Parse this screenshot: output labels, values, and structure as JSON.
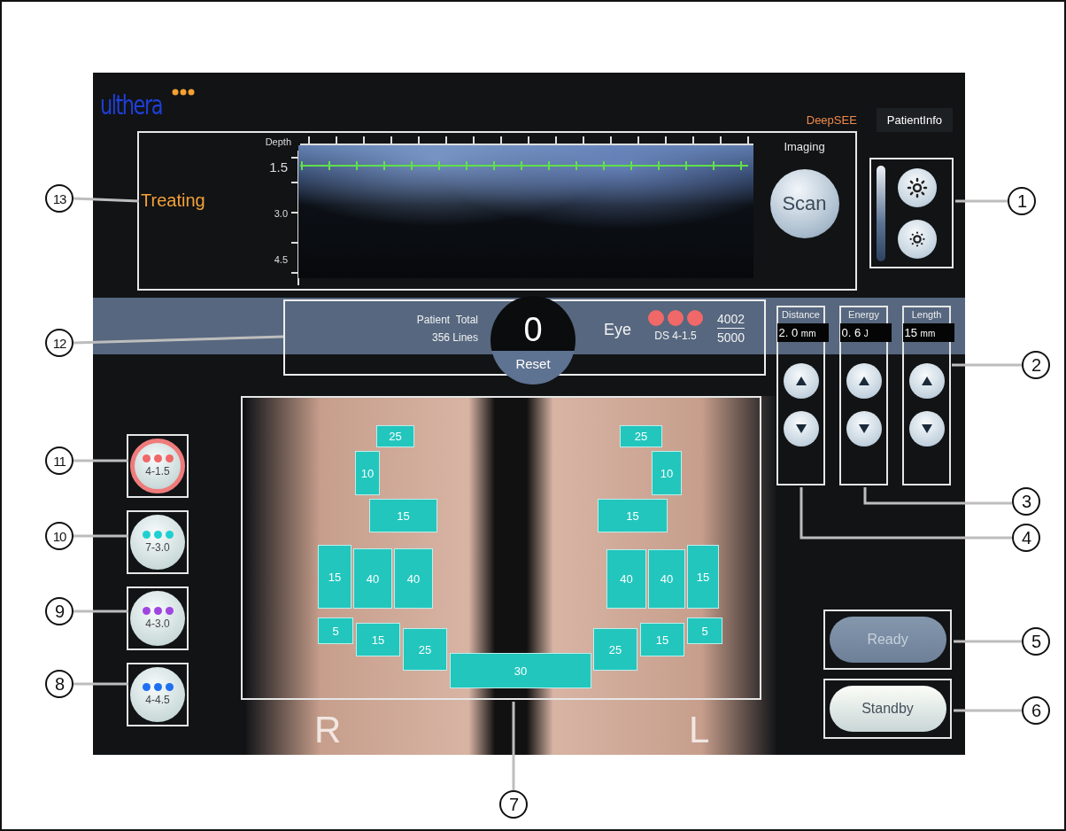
{
  "logo": {
    "text": "ulthera"
  },
  "tabs": [
    {
      "label": "DeepSEE",
      "selected": true
    },
    {
      "label": "PatientInfo",
      "selected": false
    }
  ],
  "imaging": {
    "status": "Treating",
    "depth_title": "Depth",
    "depth_labels": [
      "1.5",
      "3.0",
      "4.5"
    ],
    "title": "Imaging",
    "scan_button": "Scan"
  },
  "treatment_status": {
    "title": "Patient  Total",
    "lines": "356 Lines",
    "count": "0",
    "reset": "Reset",
    "area": "Eye",
    "transducer": "DS 4-1.5",
    "used": "4002",
    "limit": "5000"
  },
  "parameters": [
    {
      "label": "Distance",
      "value": "2. 0",
      "unit": "mm"
    },
    {
      "label": "Energy",
      "value": "0. 6",
      "unit": "J"
    },
    {
      "label": "Length",
      "value": "15",
      "unit": "mm"
    }
  ],
  "transducers": [
    {
      "label": "4-1.5",
      "color": "#f06868",
      "selected": true
    },
    {
      "label": "7-3.0",
      "color": "#1fd0d0",
      "selected": false
    },
    {
      "label": "4-3.0",
      "color": "#a046e0",
      "selected": false
    },
    {
      "label": "4-4.5",
      "color": "#1f6ff0",
      "selected": false
    }
  ],
  "zones": [
    {
      "label": "25"
    },
    {
      "label": "10"
    },
    {
      "label": "15"
    },
    {
      "label": "15"
    },
    {
      "label": "40"
    },
    {
      "label": "40"
    },
    {
      "label": "5"
    },
    {
      "label": "15"
    },
    {
      "label": "25"
    },
    {
      "label": "30"
    },
    {
      "label": "25"
    },
    {
      "label": "10"
    },
    {
      "label": "15"
    },
    {
      "label": "40"
    },
    {
      "label": "40"
    },
    {
      "label": "15"
    },
    {
      "label": "25"
    },
    {
      "label": "15"
    },
    {
      "label": "5"
    }
  ],
  "face_labels": [
    "R",
    "L"
  ],
  "actions": [
    {
      "label": "Ready",
      "disabled": true
    },
    {
      "label": "Standby",
      "disabled": false
    }
  ],
  "callouts": [
    "13",
    "1",
    "12",
    "2",
    "11",
    "3",
    "10",
    "4",
    "9",
    "5",
    "8",
    "6",
    "7"
  ]
}
